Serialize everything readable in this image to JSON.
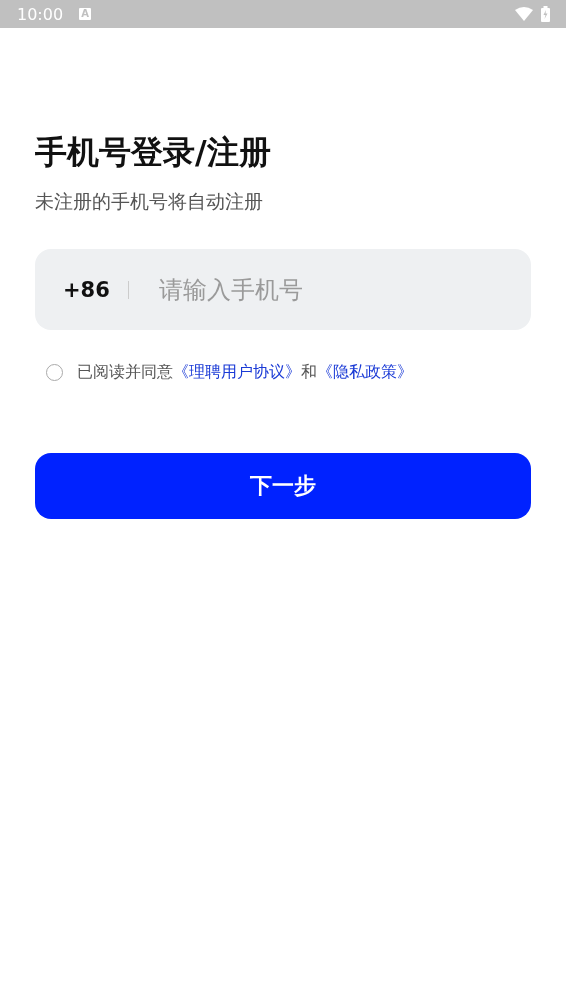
{
  "status_bar": {
    "time": "10:00",
    "notification": "A"
  },
  "title": "手机号登录/注册",
  "subtitle": "未注册的手机号将自动注册",
  "phone_field": {
    "country_code": "+86",
    "placeholder": "请输入手机号"
  },
  "agreement": {
    "checked": false,
    "parts": [
      {
        "kind": "text",
        "text": "已阅读并同意"
      },
      {
        "kind": "link",
        "text": "《理聘用户协议》"
      },
      {
        "kind": "text",
        "text": "和"
      },
      {
        "kind": "link",
        "text": "《隐私政策》"
      }
    ]
  },
  "next_button": "下一步"
}
